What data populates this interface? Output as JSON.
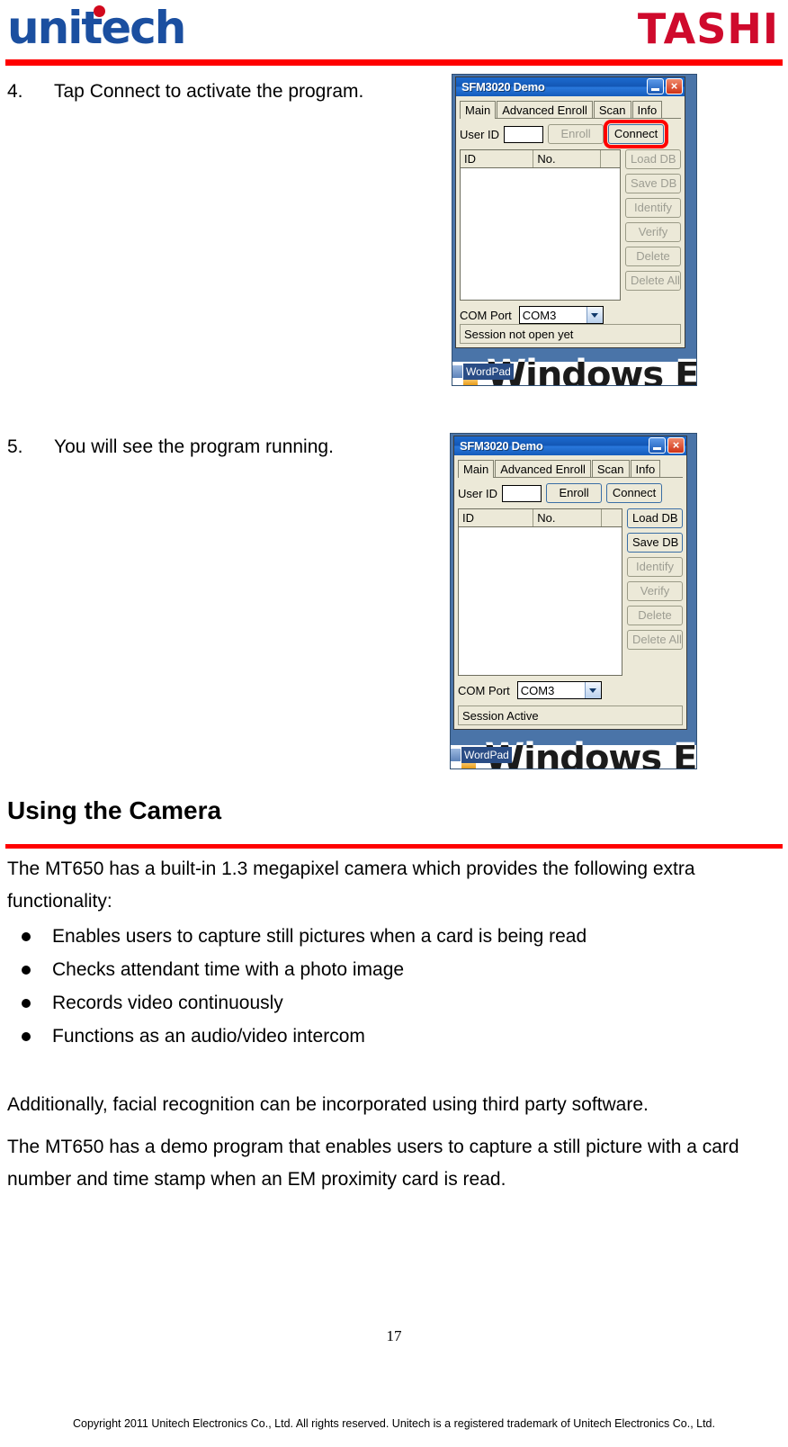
{
  "header": {
    "brand_left": "unitech",
    "brand_right": "TASHI",
    "rule_color": "#ff0000"
  },
  "steps": [
    {
      "number": "4.",
      "text": "Tap Connect to activate the program."
    },
    {
      "number": "5.",
      "text": "You will see the program running."
    }
  ],
  "screenshots": [
    {
      "title": "SFM3020 Demo",
      "minimize_label": "_",
      "close_label": "×",
      "tabs": [
        "Main",
        "Advanced Enroll",
        "Scan",
        "Info"
      ],
      "active_tab": "Main",
      "user_id_label": "User ID",
      "user_id_value": "",
      "enroll_label": "Enroll",
      "connect_label": "Connect",
      "columns": [
        "ID",
        "No.",
        ""
      ],
      "side_buttons": [
        "Load DB",
        "Save DB",
        "Identify",
        "Verify",
        "Delete",
        "Delete All"
      ],
      "enabled_buttons": [
        "Connect"
      ],
      "highlighted_button": "Connect",
      "com_port_label": "COM Port",
      "com_port_value": "COM3",
      "status": "Session not open yet",
      "taskbar_button": "WordPad",
      "desktop_watermark": "Windows Em"
    },
    {
      "title": "SFM3020 Demo",
      "minimize_label": "_",
      "close_label": "×",
      "tabs": [
        "Main",
        "Advanced Enroll",
        "Scan",
        "Info"
      ],
      "active_tab": "Main",
      "user_id_label": "User ID",
      "user_id_value": "",
      "enroll_label": "Enroll",
      "connect_label": "Connect",
      "columns": [
        "ID",
        "No.",
        ""
      ],
      "side_buttons": [
        "Load DB",
        "Save DB",
        "Identify",
        "Verify",
        "Delete",
        "Delete All"
      ],
      "enabled_buttons": [
        "Enroll",
        "Connect",
        "Load DB",
        "Save DB"
      ],
      "highlighted_button": "",
      "com_port_label": "COM Port",
      "com_port_value": "COM3",
      "status": "Session Active",
      "taskbar_button": "WordPad",
      "desktop_watermark": "Windows Em"
    }
  ],
  "section": {
    "heading": "Using the Camera",
    "intro": "The MT650 has a built-in 1.3 megapixel camera which provides the following extra functionality:",
    "bullets": [
      "Enables users to capture still pictures when a card is being read",
      "Checks attendant time with a photo image",
      "Records video continuously",
      "Functions as an audio/video intercom"
    ],
    "additional": "Additionally, facial recognition can be incorporated using third party software.",
    "demo": "The MT650 has a demo program that enables users to capture a still picture with a card number and time stamp when an EM proximity card is read."
  },
  "footer": {
    "page_number": "17",
    "copyright": "Copyright 2011 Unitech Electronics Co., Ltd. All rights reserved. Unitech is a registered trademark of Unitech Electronics Co., Ltd."
  }
}
